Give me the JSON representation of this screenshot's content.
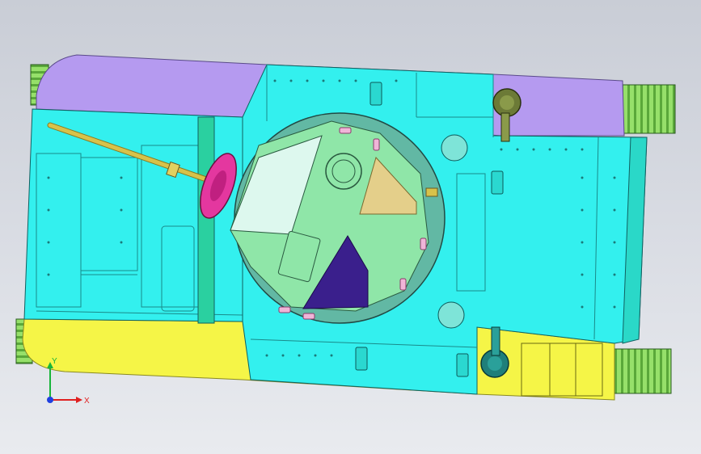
{
  "viewport": {
    "background_top": "#c9cdd6",
    "background_bottom": "#e9ebef"
  },
  "model": {
    "name": "tank-top-view",
    "colors": {
      "hull": "#33f0ee",
      "hull_dark": "#1fcfcf",
      "side_skirt_top": "#b59af0",
      "side_skirt_bottom": "#f5f547",
      "turret_ring": "#62b8a4",
      "turret_top": "#8fe6a8",
      "hatch_light": "#ddf8ee",
      "hatch_dark": "#3a1f8c",
      "hatch_tan": "#e4cf8a",
      "gun": "#d8c24a",
      "mantlet": "#e4379f",
      "track": "#96e06a",
      "cupola_olive": "#6c7a37",
      "cupola_teal": "#1f7f7a",
      "vision_ports": "#f0b5d8",
      "rivet": "#1a7a7a"
    }
  },
  "triad": {
    "x_label": "X",
    "y_label": "Y",
    "x_color": "#e02020",
    "y_color": "#18b53a",
    "z_color": "#2040e0"
  }
}
